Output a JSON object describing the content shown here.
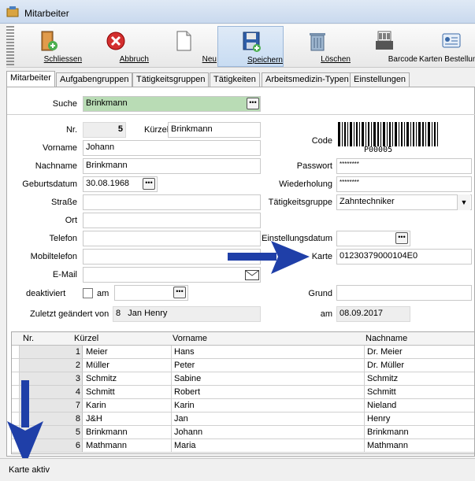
{
  "window": {
    "title": "Mitarbeiter"
  },
  "toolbar": {
    "buttons": [
      {
        "label": "Schliessen",
        "icon": "exit-door-icon"
      },
      {
        "label": "Abbruch",
        "icon": "cancel-icon"
      },
      {
        "label": "Neu",
        "icon": "new-document-icon"
      },
      {
        "label": "Speichern",
        "icon": "save-icon"
      },
      {
        "label": "Löschen",
        "icon": "delete-bin-icon"
      },
      {
        "label": "Barcode",
        "icon": "barcode-printer-icon"
      },
      {
        "label": "Karten Bestellung",
        "icon": "id-card-icon"
      }
    ]
  },
  "tabs": [
    {
      "label": "Mitarbeiter",
      "active": true
    },
    {
      "label": "Aufgabengruppen"
    },
    {
      "label": "Tätigkeitsgruppen"
    },
    {
      "label": "Tätigkeiten"
    },
    {
      "label": "Arbeitsmedizin-Typen"
    },
    {
      "label": "Einstellungen"
    }
  ],
  "form": {
    "search_label": "Suche",
    "search_value": "Brinkmann",
    "nr_label": "Nr.",
    "nr_value": "5",
    "kuerzel_label": "Kürzel",
    "kuerzel_value": "Brinkmann",
    "vorname_label": "Vorname",
    "vorname_value": "Johann",
    "nachname_label": "Nachname",
    "nachname_value": "Brinkmann",
    "geburtsdatum_label": "Geburtsdatum",
    "geburtsdatum_value": "30.08.1968",
    "strasse_label": "Straße",
    "strasse_value": "",
    "ort_label": "Ort",
    "ort_value": "",
    "telefon_label": "Telefon",
    "telefon_value": "",
    "mobil_label": "Mobiltelefon",
    "mobil_value": "",
    "email_label": "E-Mail",
    "email_value": "",
    "deaktiviert_label": "deaktiviert",
    "am_label": "am",
    "am_value": "",
    "geaendert_label": "Zuletzt geändert von",
    "geaendert_nr": "8",
    "geaendert_name": "Jan Henry",
    "code_label": "Code",
    "barcode_text": "P00005",
    "passwort_label": "Passwort",
    "passwort_value": "********",
    "wiederholung_label": "Wiederholung",
    "wiederholung_value": "********",
    "taetigkeit_label": "Tätigkeitsgruppe",
    "taetigkeit_value": "Zahntechniker",
    "einstellung_label": "Einstellungsdatum",
    "einstellung_value": "",
    "karte_label": "Karte",
    "karte_value": "01230379000104E0",
    "grund_label": "Grund",
    "grund_value": "",
    "am2_label": "am",
    "am2_value": "08.09.2017"
  },
  "grid": {
    "headers": [
      "Nr.",
      "Kürzel",
      "Vorname",
      "Nachname"
    ],
    "rows": [
      {
        "nr": "1",
        "kuerzel": "Meier",
        "vorname": "Hans",
        "nachname": "Dr. Meier"
      },
      {
        "nr": "2",
        "kuerzel": "Müller",
        "vorname": "Peter",
        "nachname": "Dr. Müller"
      },
      {
        "nr": "3",
        "kuerzel": "Schmitz",
        "vorname": "Sabine",
        "nachname": "Schmitz"
      },
      {
        "nr": "4",
        "kuerzel": "Schmitt",
        "vorname": "Robert",
        "nachname": "Schmitt"
      },
      {
        "nr": "7",
        "kuerzel": "Karin",
        "vorname": "Karin",
        "nachname": "Nieland"
      },
      {
        "nr": "8",
        "kuerzel": "J&H",
        "vorname": "Jan",
        "nachname": "Henry"
      },
      {
        "nr": "5",
        "kuerzel": "Brinkmann",
        "vorname": "Johann",
        "nachname": "Brinkmann"
      },
      {
        "nr": "6",
        "kuerzel": "Mathmann",
        "vorname": "Maria",
        "nachname": "Mathmann"
      }
    ]
  },
  "status": {
    "text": "Karte aktiv"
  },
  "colors": {
    "search_bg": "#b9dcb5",
    "arrow": "#1f3fa8",
    "selected_toolbar": "#c8dcf2"
  }
}
